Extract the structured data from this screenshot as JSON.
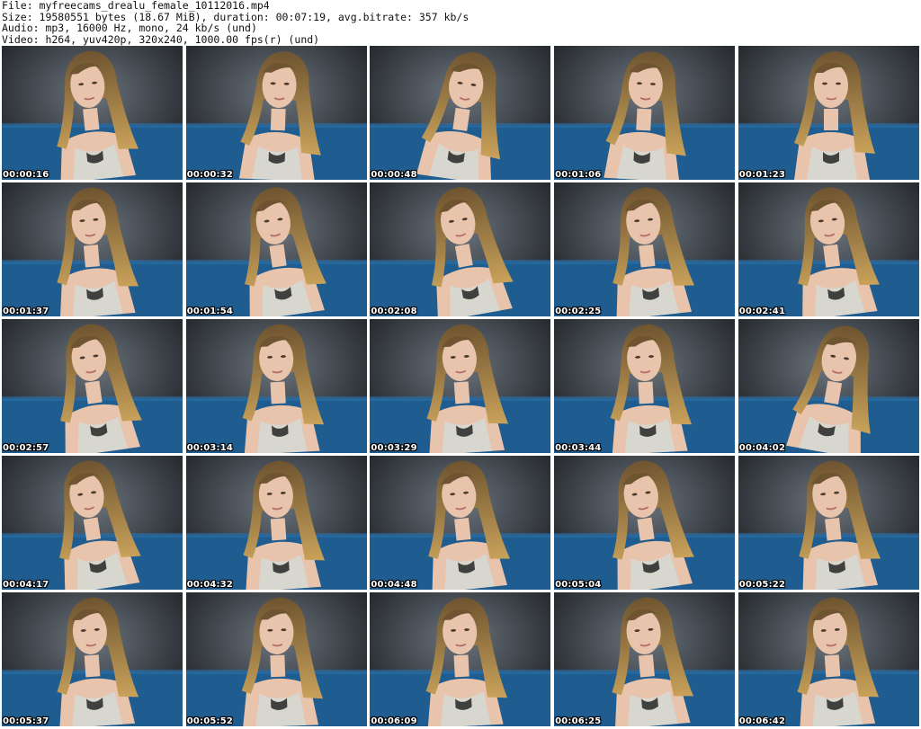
{
  "header": {
    "lines": [
      "File: myfreecams_drealu_female_10112016.mp4",
      "Size: 19580551 bytes (18.67 MiB), duration: 00:07:19, avg.bitrate: 357 kb/s",
      "Audio: mp3, 16000 Hz, mono, 24 kb/s (und)",
      "Video: h264, yuv420p, 320x240, 1000.00 fps(r) (und)"
    ]
  },
  "colors": {
    "wall": "#3a3f45",
    "sofa": "#1f5c8f",
    "skin": "#e9c4ad",
    "hair": "#8a6a3a",
    "top": "#d7d7cf"
  },
  "thumbnails": [
    {
      "timestamp": "00:00:16",
      "tilt": -6,
      "shift": -4
    },
    {
      "timestamp": "00:00:32",
      "tilt": 2,
      "shift": 2
    },
    {
      "timestamp": "00:00:48",
      "tilt": 8,
      "shift": 4
    },
    {
      "timestamp": "00:01:06",
      "tilt": 3,
      "shift": 0
    },
    {
      "timestamp": "00:01:23",
      "tilt": 0,
      "shift": 2
    },
    {
      "timestamp": "00:01:37",
      "tilt": -5,
      "shift": -3
    },
    {
      "timestamp": "00:01:54",
      "tilt": -8,
      "shift": -2
    },
    {
      "timestamp": "00:02:08",
      "tilt": -10,
      "shift": 0
    },
    {
      "timestamp": "00:02:25",
      "tilt": -6,
      "shift": 0
    },
    {
      "timestamp": "00:02:41",
      "tilt": -7,
      "shift": 0
    },
    {
      "timestamp": "00:02:57",
      "tilt": -8,
      "shift": -2
    },
    {
      "timestamp": "00:03:14",
      "tilt": -3,
      "shift": 0
    },
    {
      "timestamp": "00:03:29",
      "tilt": -4,
      "shift": 0
    },
    {
      "timestamp": "00:03:44",
      "tilt": -3,
      "shift": 0
    },
    {
      "timestamp": "00:04:02",
      "tilt": 10,
      "shift": 8
    },
    {
      "timestamp": "00:04:17",
      "tilt": -9,
      "shift": -4
    },
    {
      "timestamp": "00:04:32",
      "tilt": -4,
      "shift": 0
    },
    {
      "timestamp": "00:04:48",
      "tilt": -6,
      "shift": 0
    },
    {
      "timestamp": "00:05:04",
      "tilt": -8,
      "shift": -2
    },
    {
      "timestamp": "00:05:22",
      "tilt": -6,
      "shift": 2
    },
    {
      "timestamp": "00:05:37",
      "tilt": -4,
      "shift": -2
    },
    {
      "timestamp": "00:05:52",
      "tilt": -2,
      "shift": 0
    },
    {
      "timestamp": "00:06:09",
      "tilt": -3,
      "shift": 0
    },
    {
      "timestamp": "00:06:25",
      "tilt": -5,
      "shift": 0
    },
    {
      "timestamp": "00:06:42",
      "tilt": -4,
      "shift": 2
    }
  ]
}
